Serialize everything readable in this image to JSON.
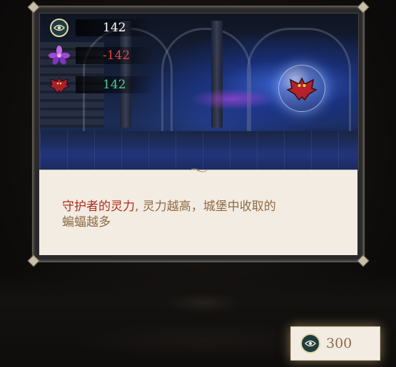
{
  "stats": [
    {
      "icon": "spirit-eye-icon",
      "value": "142",
      "color": "#ffffff"
    },
    {
      "icon": "purple-flower-icon",
      "value": "-142",
      "color": "#e0473c"
    },
    {
      "icon": "bat-crest-icon",
      "value": "142",
      "color": "#4fd08a"
    }
  ],
  "description": {
    "highlight": "守护者的灵力",
    "separator": ",",
    "line1_rest": " 灵力越高，城堡中收取的",
    "line2": "蝙蝠越多"
  },
  "cost": {
    "icon": "spirit-eye-icon",
    "value": "300"
  }
}
